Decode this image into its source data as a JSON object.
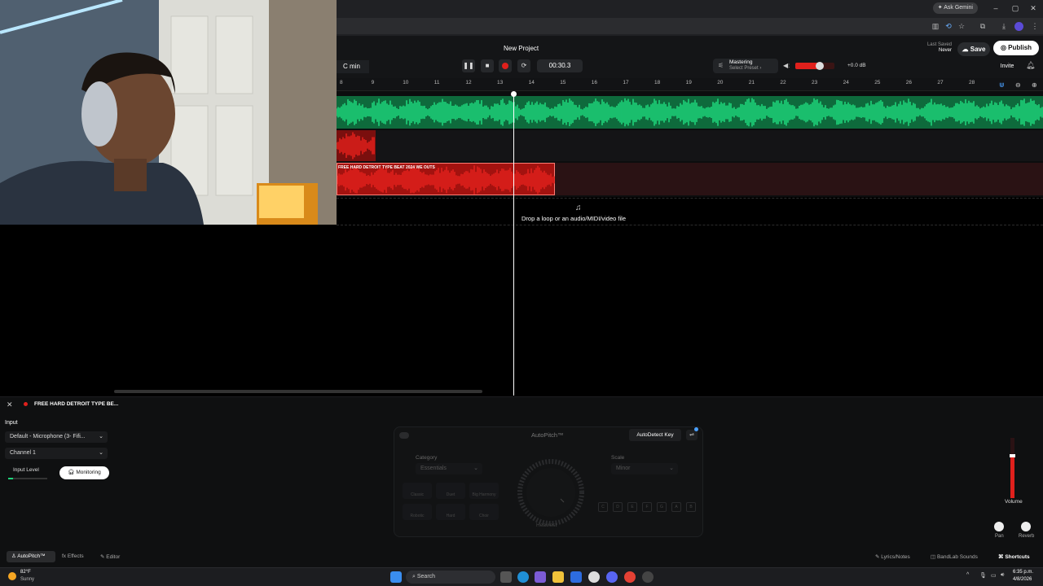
{
  "browser": {
    "ask_gemini": "Ask Gemini",
    "window_controls": [
      "–",
      "▢",
      "✕"
    ]
  },
  "header": {
    "project_title": "New Project",
    "key": "C min",
    "time": "00:30.3",
    "mastering": "Mastering",
    "select_preset": "Select Preset ›",
    "volume_db": "+0.0 dB",
    "master_volume_fraction": 0.62,
    "last_saved_label": "Last Saved",
    "last_saved_value": "Never",
    "save": "Save",
    "publish": "Publish",
    "invite": "Invite"
  },
  "ruler": [
    "8",
    "9",
    "10",
    "11",
    "12",
    "13",
    "14",
    "15",
    "16",
    "17",
    "18",
    "19",
    "20",
    "21",
    "22",
    "23",
    "24",
    "25",
    "26",
    "27",
    "28"
  ],
  "tracks": {
    "clip_name": "FREE HARD DETROIT TYPE BEAT 2024 WE OUTS",
    "drop_hint": "Drop a loop or an audio/MIDI/video file",
    "colors": {
      "green": "#1ed47a",
      "red": "#e0201c"
    }
  },
  "panel": {
    "track_name": "FREE HARD DETROIT TYPE BE...",
    "input_label": "Input",
    "input_device": "Default - Microphone (3- Fifi...",
    "channel": "Channel 1",
    "input_level": "Input Level",
    "monitoring": "Monitoring",
    "autopitch_title": "AutoPitch™",
    "autodetect": "AutoDetect Key",
    "category_label": "Category",
    "category_value": "Essentials",
    "scale_label": "Scale",
    "scale_value": "Minor",
    "presets": [
      "Classic",
      "Duet",
      "Big Harmony",
      "Robotic",
      "Hard",
      "Choir"
    ],
    "knob_label": "Heaviest",
    "keys": [
      "C",
      "D",
      "E",
      "F",
      "G",
      "A",
      "B"
    ],
    "volume": "Volume",
    "pan": "Pan",
    "reverb": "Reverb",
    "tabs": [
      "AutoPitch™",
      "Effects",
      "Editor"
    ],
    "bottom_right": [
      "Lyrics/Notes",
      "BandLab Sounds",
      "Shortcuts"
    ]
  },
  "taskbar": {
    "temp": "82°F",
    "weather": "Sunny",
    "search": "Search",
    "time": "6:35 p.m.",
    "date": "4/8/2026"
  }
}
